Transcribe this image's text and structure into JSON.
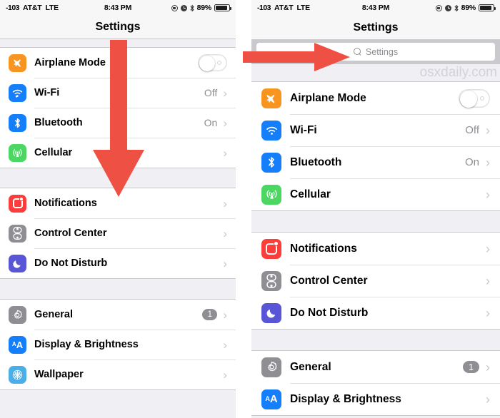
{
  "meta": {
    "watermark": "osxdaily.com",
    "accent_red": "#ef5044",
    "ios_gray_bg": "#efeff4"
  },
  "status_bar": {
    "carrier_signal": "-103",
    "carrier": "AT&T",
    "network": "LTE",
    "time": "8:43 PM",
    "battery_percent": "89%",
    "icons": [
      "lock-rotation-icon",
      "alarm-clock-icon",
      "bluetooth-icon",
      "battery-icon"
    ]
  },
  "nav": {
    "title": "Settings"
  },
  "search": {
    "placeholder": "Settings",
    "icon": "search-icon"
  },
  "groups": [
    {
      "id": "connectivity",
      "rows": [
        {
          "id": "airplane-mode",
          "label": "Airplane Mode",
          "icon": "airplane-icon",
          "icon_color": "#f79520",
          "control": "toggle",
          "toggle_on": false
        },
        {
          "id": "wifi",
          "label": "Wi-Fi",
          "icon": "wifi-icon",
          "icon_color": "#147efb",
          "value": "Off",
          "control": "chevron"
        },
        {
          "id": "bluetooth",
          "label": "Bluetooth",
          "icon": "bluetooth-icon",
          "icon_color": "#147efb",
          "value": "On",
          "control": "chevron"
        },
        {
          "id": "cellular",
          "label": "Cellular",
          "icon": "cellular-icon",
          "icon_color": "#4cd763",
          "value": "",
          "control": "chevron"
        }
      ]
    },
    {
      "id": "alerts",
      "rows": [
        {
          "id": "notifications",
          "label": "Notifications",
          "icon": "notifications-icon",
          "icon_color": "#fc3d39",
          "value": "",
          "control": "chevron"
        },
        {
          "id": "control-center",
          "label": "Control Center",
          "icon": "control-center-icon",
          "icon_color": "#8e8e93",
          "value": "",
          "control": "chevron"
        },
        {
          "id": "do-not-disturb",
          "label": "Do Not Disturb",
          "icon": "moon-icon",
          "icon_color": "#5856d6",
          "value": "",
          "control": "chevron"
        }
      ]
    },
    {
      "id": "system",
      "rows": [
        {
          "id": "general",
          "label": "General",
          "icon": "gear-icon",
          "icon_color": "#8e8e93",
          "badge": "1",
          "control": "chevron"
        },
        {
          "id": "display-brightness",
          "label": "Display & Brightness",
          "icon": "display-brightness-icon",
          "icon_color": "#147efb",
          "value": "",
          "control": "chevron"
        },
        {
          "id": "wallpaper",
          "label": "Wallpaper",
          "icon": "wallpaper-icon",
          "icon_color": "#4aaee8",
          "value": "",
          "control": "chevron"
        }
      ]
    }
  ],
  "annotations": [
    {
      "id": "swipe-down-arrow",
      "direction": "down",
      "color": "#ef5044"
    },
    {
      "id": "search-bar-pointer-arrow",
      "direction": "right",
      "color": "#ef5044"
    }
  ]
}
